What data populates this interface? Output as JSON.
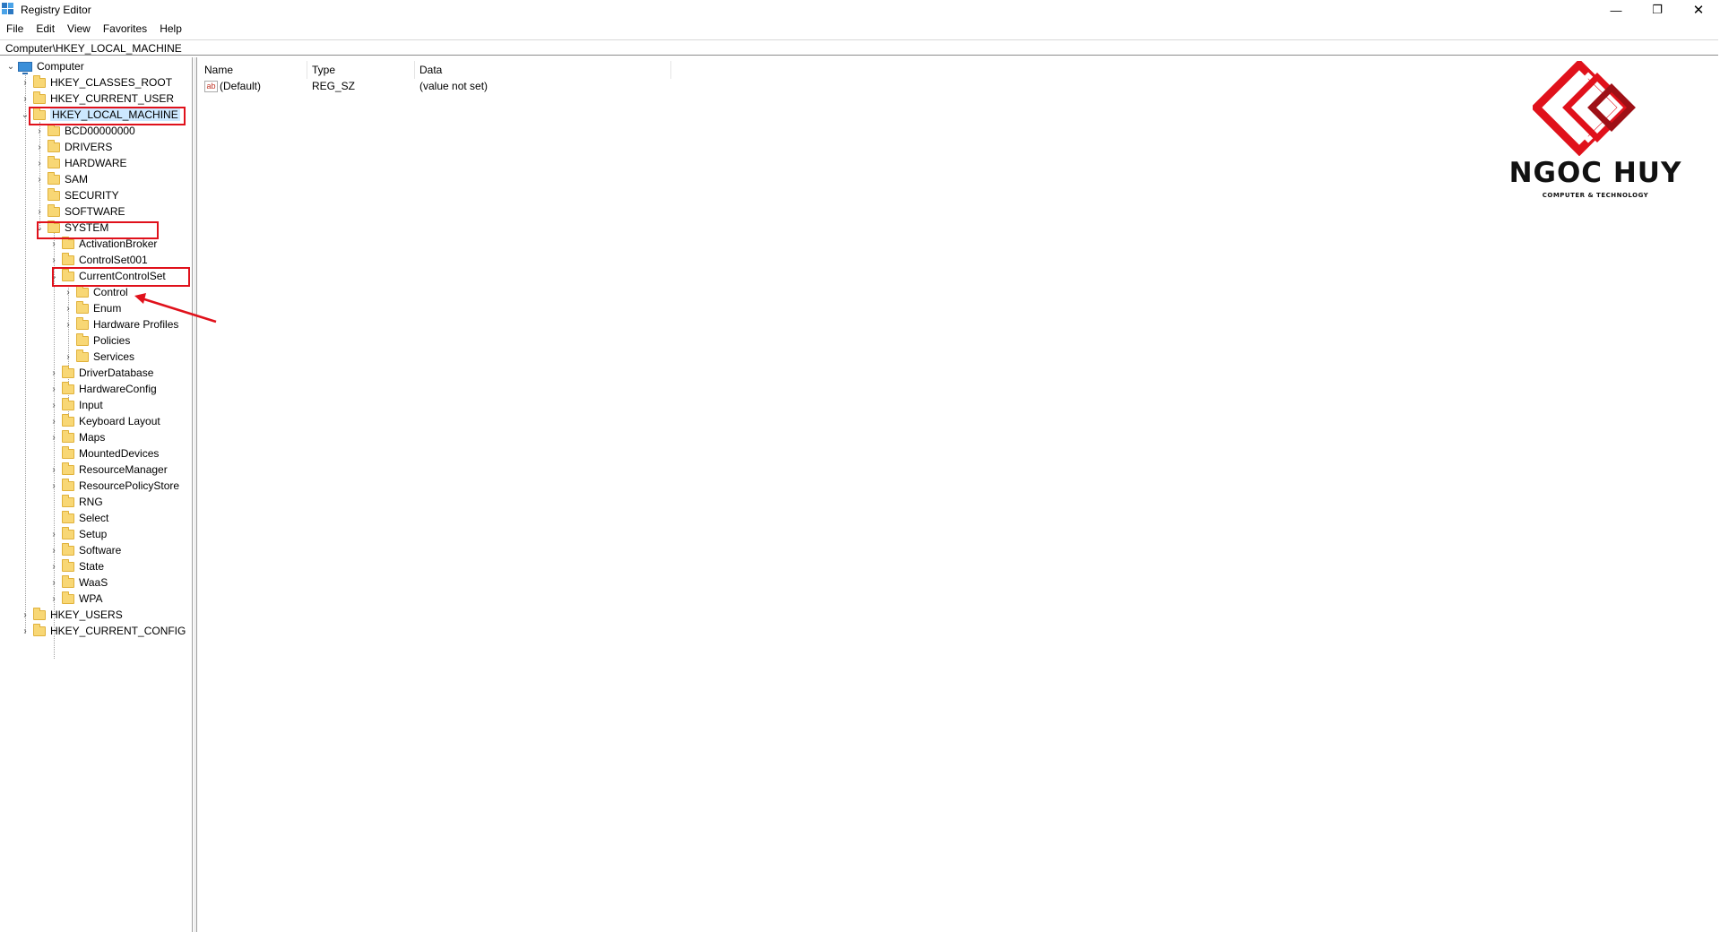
{
  "window": {
    "title": "Registry Editor",
    "controls": {
      "minimize": "—",
      "maximize": "❐",
      "close": "✕"
    }
  },
  "menu": [
    "File",
    "Edit",
    "View",
    "Favorites",
    "Help"
  ],
  "address": "Computer\\HKEY_LOCAL_MACHINE",
  "tree": [
    {
      "label": "Computer",
      "level": 0,
      "expander": "expanded",
      "icon": "computer-icon"
    },
    {
      "label": "HKEY_CLASSES_ROOT",
      "level": 1,
      "expander": "collapsed",
      "icon": "folder-icon"
    },
    {
      "label": "HKEY_CURRENT_USER",
      "level": 1,
      "expander": "collapsed",
      "icon": "folder-icon"
    },
    {
      "label": "HKEY_LOCAL_MACHINE",
      "level": 1,
      "expander": "expanded",
      "icon": "folder-icon",
      "selected": true
    },
    {
      "label": "BCD00000000",
      "level": 2,
      "expander": "collapsed",
      "icon": "folder-icon"
    },
    {
      "label": "DRIVERS",
      "level": 2,
      "expander": "collapsed",
      "icon": "folder-icon"
    },
    {
      "label": "HARDWARE",
      "level": 2,
      "expander": "collapsed",
      "icon": "folder-icon"
    },
    {
      "label": "SAM",
      "level": 2,
      "expander": "collapsed",
      "icon": "folder-icon"
    },
    {
      "label": "SECURITY",
      "level": 2,
      "expander": "none",
      "icon": "folder-icon"
    },
    {
      "label": "SOFTWARE",
      "level": 2,
      "expander": "collapsed",
      "icon": "folder-icon"
    },
    {
      "label": "SYSTEM",
      "level": 2,
      "expander": "expanded",
      "icon": "folder-icon"
    },
    {
      "label": "ActivationBroker",
      "level": 3,
      "expander": "collapsed",
      "icon": "folder-icon"
    },
    {
      "label": "ControlSet001",
      "level": 3,
      "expander": "collapsed",
      "icon": "folder-icon"
    },
    {
      "label": "CurrentControlSet",
      "level": 3,
      "expander": "expanded",
      "icon": "folder-icon"
    },
    {
      "label": "Control",
      "level": 4,
      "expander": "collapsed",
      "icon": "folder-icon"
    },
    {
      "label": "Enum",
      "level": 4,
      "expander": "collapsed",
      "icon": "folder-icon"
    },
    {
      "label": "Hardware Profiles",
      "level": 4,
      "expander": "collapsed",
      "icon": "folder-icon"
    },
    {
      "label": "Policies",
      "level": 4,
      "expander": "none",
      "icon": "folder-icon"
    },
    {
      "label": "Services",
      "level": 4,
      "expander": "collapsed",
      "icon": "folder-icon"
    },
    {
      "label": "DriverDatabase",
      "level": 3,
      "expander": "collapsed",
      "icon": "folder-icon"
    },
    {
      "label": "HardwareConfig",
      "level": 3,
      "expander": "collapsed",
      "icon": "folder-icon"
    },
    {
      "label": "Input",
      "level": 3,
      "expander": "collapsed",
      "icon": "folder-icon"
    },
    {
      "label": "Keyboard Layout",
      "level": 3,
      "expander": "collapsed",
      "icon": "folder-icon"
    },
    {
      "label": "Maps",
      "level": 3,
      "expander": "collapsed",
      "icon": "folder-icon"
    },
    {
      "label": "MountedDevices",
      "level": 3,
      "expander": "none",
      "icon": "folder-icon"
    },
    {
      "label": "ResourceManager",
      "level": 3,
      "expander": "collapsed",
      "icon": "folder-icon"
    },
    {
      "label": "ResourcePolicyStore",
      "level": 3,
      "expander": "collapsed",
      "icon": "folder-icon"
    },
    {
      "label": "RNG",
      "level": 3,
      "expander": "none",
      "icon": "folder-icon"
    },
    {
      "label": "Select",
      "level": 3,
      "expander": "none",
      "icon": "folder-icon"
    },
    {
      "label": "Setup",
      "level": 3,
      "expander": "collapsed",
      "icon": "folder-icon"
    },
    {
      "label": "Software",
      "level": 3,
      "expander": "collapsed",
      "icon": "folder-icon"
    },
    {
      "label": "State",
      "level": 3,
      "expander": "collapsed",
      "icon": "folder-icon"
    },
    {
      "label": "WaaS",
      "level": 3,
      "expander": "collapsed",
      "icon": "folder-icon"
    },
    {
      "label": "WPA",
      "level": 3,
      "expander": "collapsed",
      "icon": "folder-icon"
    },
    {
      "label": "HKEY_USERS",
      "level": 1,
      "expander": "collapsed",
      "icon": "folder-icon"
    },
    {
      "label": "HKEY_CURRENT_CONFIG",
      "level": 1,
      "expander": "collapsed",
      "icon": "folder-icon"
    }
  ],
  "list": {
    "columns": [
      "Name",
      "Type",
      "Data"
    ],
    "rows": [
      {
        "name": "(Default)",
        "type": "REG_SZ",
        "data": "(value not set)",
        "icon": "string-value-icon"
      }
    ]
  },
  "annotation_color": "#e0111b",
  "logo": {
    "title": "NGOC HUY",
    "subtitle": "COMPUTER & TECHNOLOGY",
    "color": "#e0111b"
  }
}
